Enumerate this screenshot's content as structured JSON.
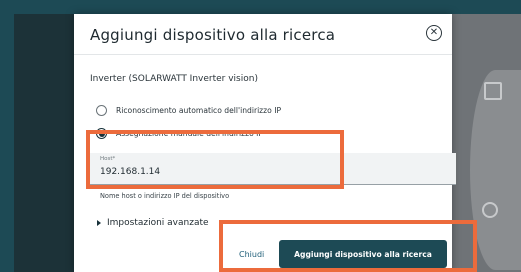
{
  "dialog": {
    "title": "Aggiungi dispositivo alla ricerca",
    "subtitle": "Inverter (SOLARWATT Inverter vision)",
    "options": [
      {
        "label": "Riconoscimento automatico dell'indirizzo IP",
        "selected": false
      },
      {
        "label": "Assegnazione manuale dell'indirizzo IP",
        "selected": true
      }
    ],
    "host_field": {
      "label": "Host*",
      "value": "192.168.1.14",
      "helper": "Nome host o indirizzo IP del dispositivo"
    },
    "advanced_label": "Impostazioni avanzate",
    "cancel_label": "Chiudi",
    "submit_label": "Aggiungi dispositivo alla ricerca"
  },
  "colors": {
    "accent": "#1d4a55",
    "highlight": "#ec6b3c"
  }
}
